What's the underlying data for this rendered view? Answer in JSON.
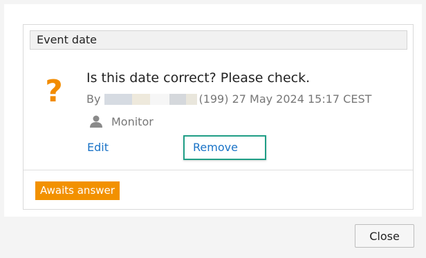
{
  "section": {
    "header": "Event date"
  },
  "question": {
    "icon": "question-mark-icon",
    "icon_char": "?",
    "title": "Is this date correct? Please check.",
    "meta_prefix": "By",
    "meta_suffix": "(199) 27 May 2024 15:17 CEST",
    "role": "Monitor",
    "role_icon": "user-icon"
  },
  "actions": {
    "edit_label": "Edit",
    "remove_label": "Remove"
  },
  "status": {
    "label": "Awaits answer",
    "color": "#f29100"
  },
  "footer": {
    "close_label": "Close"
  },
  "colors": {
    "accent": "#f28c00",
    "link": "#1a73c7",
    "highlight": "#1f9e86"
  }
}
